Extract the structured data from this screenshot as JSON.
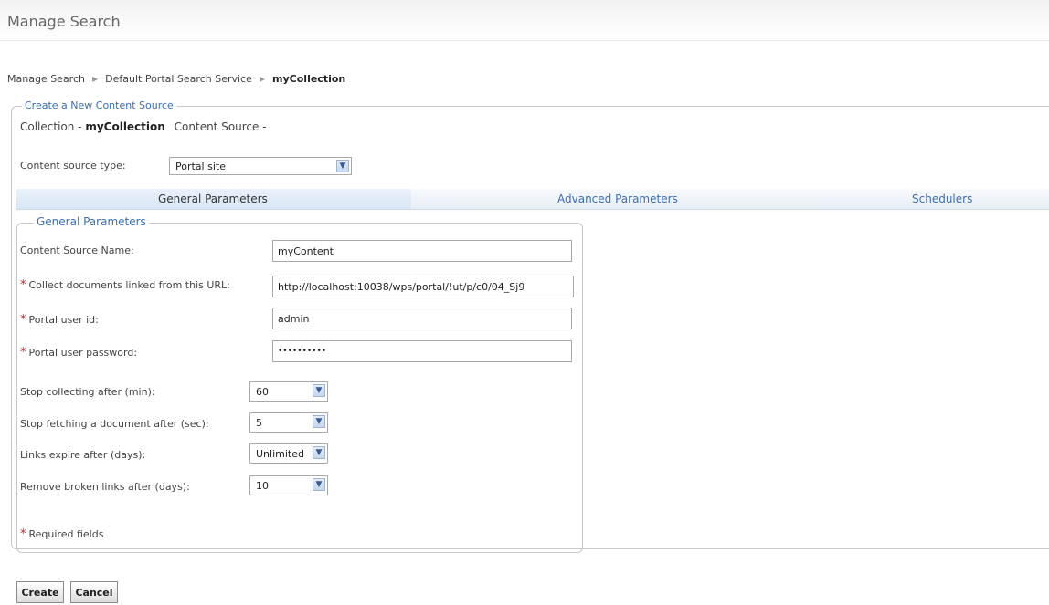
{
  "header": {
    "title": "Manage Search"
  },
  "breadcrumb": {
    "items": [
      "Manage Search",
      "Default Portal Search Service",
      "myCollection"
    ],
    "separator": "▶"
  },
  "outer_section": {
    "legend": "Create a New Content Source",
    "collection_label": "Collection - ",
    "collection_name": "myCollection",
    "content_source_label": "Content Source -",
    "content_source_type_label": "Content source type:",
    "content_source_type_value": "Portal site"
  },
  "tabs": [
    {
      "label": "General Parameters",
      "active": true
    },
    {
      "label": "Advanced Parameters",
      "active": false
    },
    {
      "label": "Schedulers",
      "active": false
    }
  ],
  "general": {
    "legend": "General Parameters",
    "fields": {
      "name": {
        "label": "Content Source Name:",
        "value": "myContent",
        "required": false
      },
      "url": {
        "label": "Collect documents linked from this URL:",
        "value": "http://localhost:10038/wps/portal/!ut/p/c0/04_Sj9",
        "required": true
      },
      "userid": {
        "label": "Portal user id:",
        "value": "admin",
        "required": true
      },
      "password": {
        "label": "Portal user password:",
        "value": "••••••••••",
        "required": true
      }
    },
    "selects": {
      "stop_collecting": {
        "label": "Stop collecting after (min):",
        "value": "60"
      },
      "stop_fetching": {
        "label": "Stop fetching a document after (sec):",
        "value": "5"
      },
      "links_expire": {
        "label": "Links expire after (days):",
        "value": "Unlimited"
      },
      "remove_broken": {
        "label": "Remove broken links after (days):",
        "value": "10"
      }
    },
    "required_marker": "*",
    "required_note": "Required fields"
  },
  "buttons": {
    "create": "Create",
    "cancel": "Cancel"
  },
  "icons": {
    "dropdown": "chevron-down-icon",
    "breadcrumb_separator": "triangle-right-icon"
  },
  "colors": {
    "accent": "#3a6fb0",
    "required": "#d02020"
  }
}
